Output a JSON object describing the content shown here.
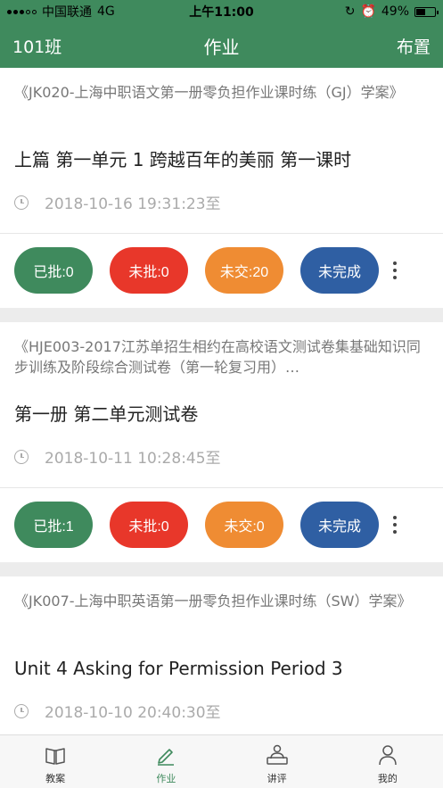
{
  "status": {
    "carrier": "中国联通",
    "network": "4G",
    "time": "上午11:00",
    "battery": "49%",
    "battery_level": 0.49
  },
  "nav": {
    "left": "101班",
    "title": "作业",
    "right": "布置"
  },
  "cards": [
    {
      "book": "《JK020-上海中职语文第一册零负担作业课时练（GJ）学案》",
      "lesson": "上篇 第一单元 1 跨越百年的美丽 第一课时",
      "time": "2018-10-16 19:31:23至",
      "approved": "已批:0",
      "unapproved": "未批:0",
      "unsubmitted": "未交:20",
      "incomplete": "未完成"
    },
    {
      "book": "《HJE003-2017江苏单招生相约在高校语文测试卷集基础知识同步训练及阶段综合测试卷（第一轮复习用）…",
      "lesson": "第一册 第二单元测试卷",
      "time": "2018-10-11 10:28:45至",
      "approved": "已批:1",
      "unapproved": "未批:0",
      "unsubmitted": "未交:0",
      "incomplete": "未完成"
    },
    {
      "book": "《JK007-上海中职英语第一册零负担作业课时练（SW）学案》",
      "lesson": "Unit 4 Asking for Permission Period 3",
      "time": "2018-10-10 20:40:30至"
    }
  ],
  "tabs": [
    {
      "label": "教案",
      "icon": "book-icon",
      "active": false
    },
    {
      "label": "作业",
      "icon": "pen-icon",
      "active": true
    },
    {
      "label": "讲评",
      "icon": "lecture-icon",
      "active": false
    },
    {
      "label": "我的",
      "icon": "user-icon",
      "active": false
    }
  ],
  "colors": {
    "brand": "#3f8a5d",
    "approved": "#3f8a5d",
    "unapproved": "#e8372a",
    "unsubmitted": "#ef8c33",
    "incomplete": "#2f5fa3"
  }
}
